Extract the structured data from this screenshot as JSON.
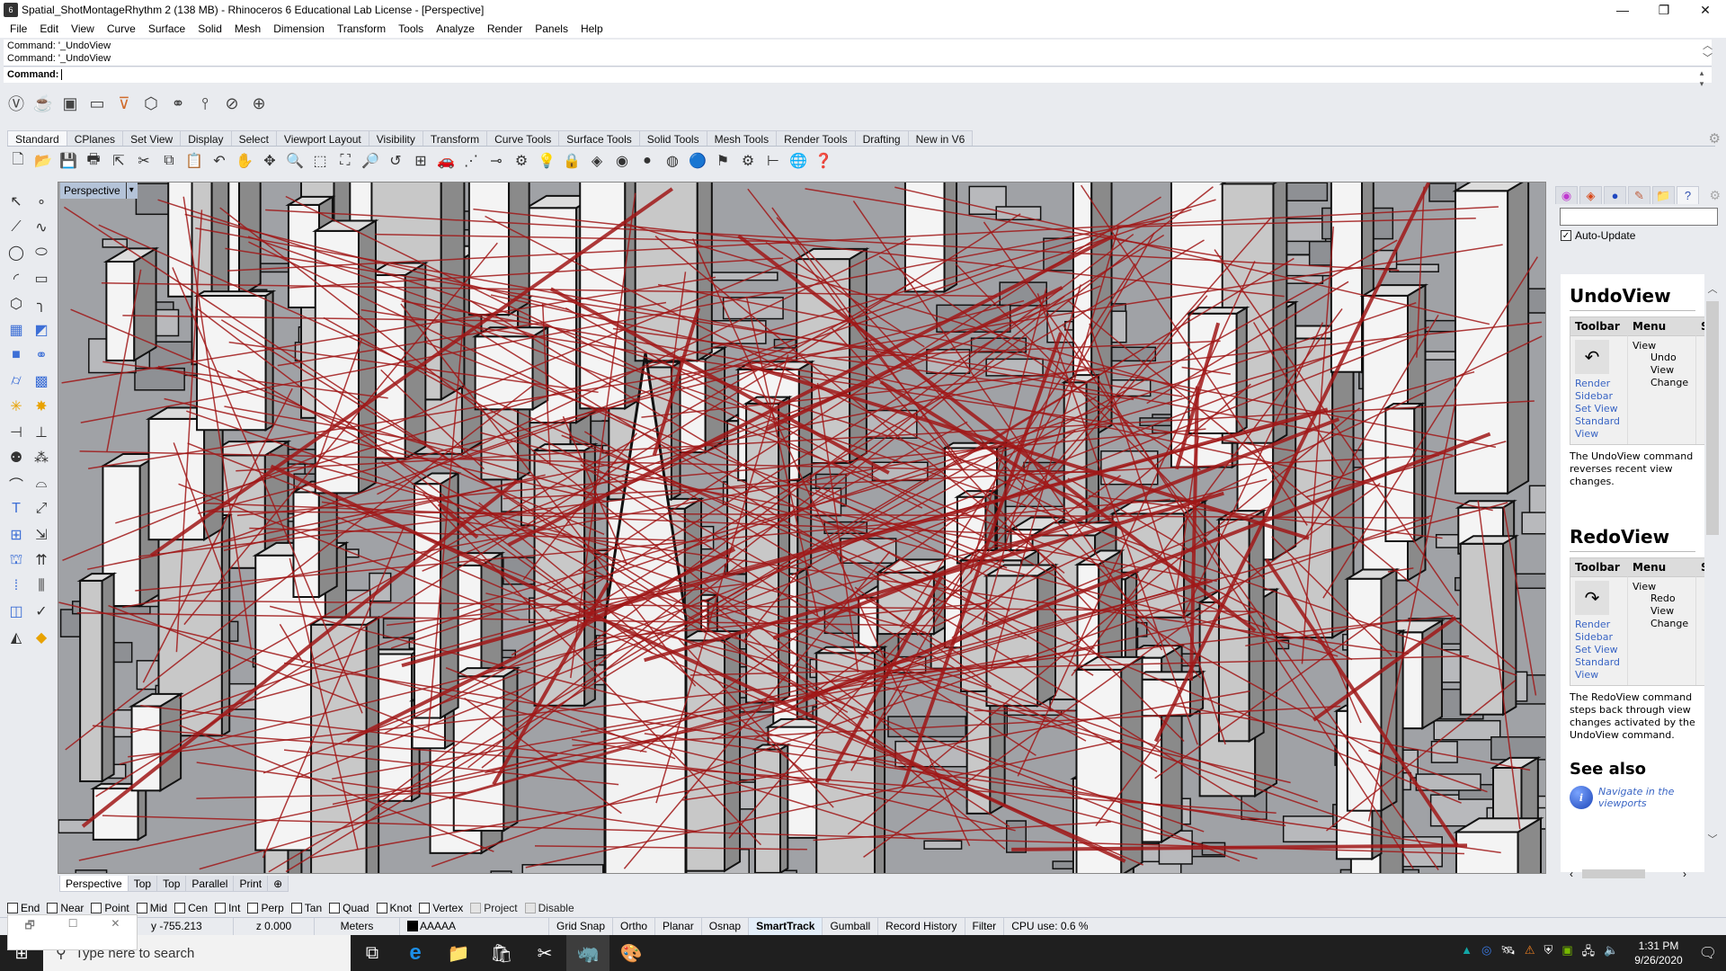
{
  "window": {
    "title": "Spatial_ShotMontageRhythm 2 (138 MB) - Rhinoceros 6 Educational Lab License - [Perspective]",
    "controls": {
      "minimize": "—",
      "restore": "❐",
      "close": "✕"
    }
  },
  "menubar": [
    "File",
    "Edit",
    "View",
    "Curve",
    "Surface",
    "Solid",
    "Mesh",
    "Dimension",
    "Transform",
    "Tools",
    "Analyze",
    "Render",
    "Panels",
    "Help"
  ],
  "command": {
    "history": [
      "Command: '_UndoView",
      "Command: '_UndoView"
    ],
    "prompt_label": "Command:",
    "value": ""
  },
  "top_toolbar_icons": [
    "vray-logo-icon",
    "teapot-render-icon",
    "frame-buffer-icon",
    "window-icon",
    "light-funnel-icon",
    "cube-light-icon",
    "infinite-plane-icon",
    "fur-icon",
    "mesh-clipper-icon",
    "camera-target-icon"
  ],
  "tabs": {
    "items": [
      "Standard",
      "CPlanes",
      "Set View",
      "Display",
      "Select",
      "Viewport Layout",
      "Visibility",
      "Transform",
      "Curve Tools",
      "Surface Tools",
      "Solid Tools",
      "Mesh Tools",
      "Render Tools",
      "Drafting",
      "New in V6"
    ],
    "active": "Standard"
  },
  "standard_toolbar_icons": [
    {
      "name": "new-file-icon",
      "glyph": "🗋"
    },
    {
      "name": "open-folder-icon",
      "glyph": "📂"
    },
    {
      "name": "save-icon",
      "glyph": "💾"
    },
    {
      "name": "print-icon",
      "glyph": "🖶"
    },
    {
      "name": "export-icon",
      "glyph": "⇱"
    },
    {
      "name": "cut-icon",
      "glyph": "✂"
    },
    {
      "name": "copy-icon",
      "glyph": "⧉"
    },
    {
      "name": "paste-icon",
      "glyph": "📋"
    },
    {
      "name": "undo-icon",
      "glyph": "↶"
    },
    {
      "name": "pan-hand-icon",
      "glyph": "✋"
    },
    {
      "name": "rotate-view-icon",
      "glyph": "✥"
    },
    {
      "name": "zoom-dynamic-icon",
      "glyph": "🔍"
    },
    {
      "name": "zoom-window-icon",
      "glyph": "⬚"
    },
    {
      "name": "zoom-extents-icon",
      "glyph": "⛶"
    },
    {
      "name": "zoom-selected-icon",
      "glyph": "🔎"
    },
    {
      "name": "undo-view-icon",
      "glyph": "↺"
    },
    {
      "name": "four-viewports-icon",
      "glyph": "⊞"
    },
    {
      "name": "car-icon",
      "glyph": "🚗"
    },
    {
      "name": "grid-snap-icon",
      "glyph": "⋰"
    },
    {
      "name": "distance-icon",
      "glyph": "⊸"
    },
    {
      "name": "properties-icon",
      "glyph": "⚙"
    },
    {
      "name": "light-bulb-icon",
      "glyph": "💡"
    },
    {
      "name": "lock-icon",
      "glyph": "🔒"
    },
    {
      "name": "material-icon",
      "glyph": "◈"
    },
    {
      "name": "color-wheel-icon",
      "glyph": "◉"
    },
    {
      "name": "render-sphere-icon",
      "glyph": "●"
    },
    {
      "name": "rendered-sphere-icon",
      "glyph": "◍"
    },
    {
      "name": "blue-sphere-icon",
      "glyph": "🔵"
    },
    {
      "name": "flag-icon",
      "glyph": "⚑"
    },
    {
      "name": "gear-icon",
      "glyph": "⚙"
    },
    {
      "name": "dimension-icon",
      "glyph": "⊢"
    },
    {
      "name": "grasshopper-icon",
      "glyph": "🌐"
    },
    {
      "name": "help-icon",
      "glyph": "❓"
    }
  ],
  "left_toolbar_icons": [
    {
      "name": "select-arrow-icon",
      "glyph": "↖"
    },
    {
      "name": "point-icon",
      "glyph": "∘"
    },
    {
      "name": "polyline-icon",
      "glyph": "⟋"
    },
    {
      "name": "curve-icon",
      "glyph": "∿"
    },
    {
      "name": "circle-icon",
      "glyph": "◯"
    },
    {
      "name": "ellipse-icon",
      "glyph": "⬭"
    },
    {
      "name": "arc-icon",
      "glyph": "◜"
    },
    {
      "name": "rectangle-icon",
      "glyph": "▭"
    },
    {
      "name": "polygon-icon",
      "glyph": "⬡"
    },
    {
      "name": "fillet-curve-icon",
      "glyph": "╮"
    },
    {
      "name": "surface-corners-icon",
      "glyph": "▦"
    },
    {
      "name": "extrude-surface-icon",
      "glyph": "◩"
    },
    {
      "name": "box-icon",
      "glyph": "■"
    },
    {
      "name": "boolean-union-icon",
      "glyph": "⚭"
    },
    {
      "name": "cylinder-icon",
      "glyph": "⌭"
    },
    {
      "name": "mesh-icon",
      "glyph": "▩"
    },
    {
      "name": "puzzle-icon",
      "glyph": "✳"
    },
    {
      "name": "explode-icon",
      "glyph": "✸"
    },
    {
      "name": "extend-icon",
      "glyph": "⊣"
    },
    {
      "name": "split-icon",
      "glyph": "⊥"
    },
    {
      "name": "group-icon",
      "glyph": "⚉"
    },
    {
      "name": "ungroup-icon",
      "glyph": "⁂"
    },
    {
      "name": "edit-points-icon",
      "glyph": "⌒"
    },
    {
      "name": "offset-curve-icon",
      "glyph": "⌓"
    },
    {
      "name": "text-icon",
      "glyph": "T"
    },
    {
      "name": "scale-icon",
      "glyph": "⤢"
    },
    {
      "name": "array-icon",
      "glyph": "⊞"
    },
    {
      "name": "mirror-icon",
      "glyph": "⇲"
    },
    {
      "name": "solid-edit-icon",
      "glyph": "⛫"
    },
    {
      "name": "extrude-icon",
      "glyph": "⇈"
    },
    {
      "name": "grid-array-icon",
      "glyph": "⁞"
    },
    {
      "name": "align-icon",
      "glyph": "⫼"
    },
    {
      "name": "flow-icon",
      "glyph": "◫"
    },
    {
      "name": "check-icon",
      "glyph": "✓"
    },
    {
      "name": "shapes-icon",
      "glyph": "◭"
    },
    {
      "name": "render-object-icon",
      "glyph": "◆"
    }
  ],
  "viewport": {
    "label": "Perspective",
    "dropdown_glyph": "▾",
    "colors": {
      "background": "#a0a2a6",
      "building_light": "#f4f4f4",
      "building_mid": "#c8c8c8",
      "building_dark": "#8a8a8a",
      "lines": "#a01818",
      "edges": "#111111"
    }
  },
  "viewport_tabs": {
    "items": [
      "Perspective",
      "Top",
      "Top",
      "Parallel",
      "Print"
    ],
    "add_glyph": "⊕",
    "active": "Perspective"
  },
  "osnap": [
    {
      "label": "End",
      "checked": false,
      "enabled": true
    },
    {
      "label": "Near",
      "checked": false,
      "enabled": true
    },
    {
      "label": "Point",
      "checked": false,
      "enabled": true
    },
    {
      "label": "Mid",
      "checked": false,
      "enabled": true
    },
    {
      "label": "Cen",
      "checked": false,
      "enabled": true
    },
    {
      "label": "Int",
      "checked": false,
      "enabled": true
    },
    {
      "label": "Perp",
      "checked": false,
      "enabled": true
    },
    {
      "label": "Tan",
      "checked": false,
      "enabled": true
    },
    {
      "label": "Quad",
      "checked": false,
      "enabled": true
    },
    {
      "label": "Knot",
      "checked": false,
      "enabled": true
    },
    {
      "label": "Vertex",
      "checked": false,
      "enabled": true
    },
    {
      "label": "Project",
      "checked": false,
      "enabled": false
    },
    {
      "label": "Disable",
      "checked": false,
      "enabled": false
    }
  ],
  "statusbar": {
    "y": "y -755.213",
    "z": "z 0.000",
    "units": "Meters",
    "layer": "AAAAA",
    "layer_color": "#000000",
    "toggles": [
      "Grid Snap",
      "Ortho",
      "Planar",
      "Osnap",
      "SmartTrack",
      "Gumball",
      "Record History",
      "Filter"
    ],
    "bold_toggle": "SmartTrack",
    "cpu": "CPU use: 0.6 %"
  },
  "mini_window": {
    "restore": "🗗",
    "maximize": "☐",
    "close": "✕"
  },
  "right_panel": {
    "tab_icons": [
      {
        "name": "color-wheel-tab-icon",
        "glyph": "◉"
      },
      {
        "name": "layers-tab-icon",
        "glyph": "◈"
      },
      {
        "name": "render-tab-icon",
        "glyph": "●"
      },
      {
        "name": "brush-tab-icon",
        "glyph": "✎"
      },
      {
        "name": "folder-tab-icon",
        "glyph": "📁"
      },
      {
        "name": "help-tab-icon",
        "glyph": "?"
      }
    ],
    "settings_glyph": "⚙",
    "search_value": "",
    "auto_update_label": "Auto-Update",
    "auto_update_checked": true,
    "sections": [
      {
        "title": "UndoView",
        "col_toolbar": "Toolbar",
        "col_menu": "Menu",
        "col_s": "S",
        "tool_links": [
          "Render",
          "Sidebar",
          "Set View",
          "Standard",
          "View"
        ],
        "menu_root": "View",
        "menu_item": "Undo View Change",
        "description": "The UndoView command reverses recent view changes."
      },
      {
        "title": "RedoView",
        "col_toolbar": "Toolbar",
        "col_menu": "Menu",
        "col_s": "S",
        "tool_links": [
          "Render",
          "Sidebar",
          "Set View",
          "Standard",
          "View"
        ],
        "menu_root": "View",
        "menu_item": "Redo View Change",
        "description": "The RedoView command steps back through view changes activated by the UndoView command."
      }
    ],
    "see_also": "See also",
    "see_also_link": "Navigate in the viewports"
  },
  "taskbar": {
    "search_placeholder": "Type here to search",
    "apps": [
      {
        "name": "task-view-icon",
        "glyph": "⧉",
        "active": false
      },
      {
        "name": "edge-icon",
        "glyph": "e",
        "active": false
      },
      {
        "name": "file-explorer-icon",
        "glyph": "📁",
        "active": false
      },
      {
        "name": "store-icon",
        "glyph": "🛍",
        "active": false
      },
      {
        "name": "snip-sketch-icon",
        "glyph": "✂",
        "active": false
      },
      {
        "name": "rhino-icon",
        "glyph": "🦏",
        "active": true
      },
      {
        "name": "paint-icon",
        "glyph": "🎨",
        "active": false
      }
    ],
    "tray_icons": [
      "autodesk-icon",
      "sync-icon",
      "satellite-icon",
      "warning-icon",
      "security-icon",
      "nvidia-icon",
      "network-icon",
      "volume-icon"
    ],
    "time": "1:31 PM",
    "date": "9/26/2020"
  }
}
